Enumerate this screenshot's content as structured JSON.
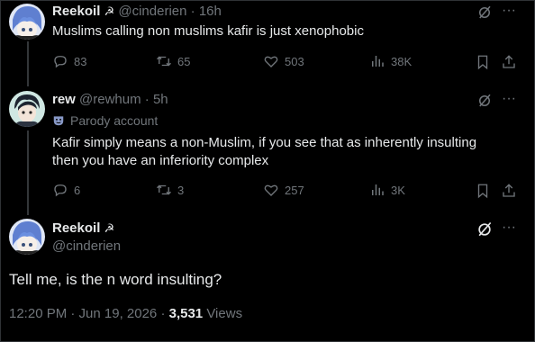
{
  "tweets": [
    {
      "display_name": "Reekoil",
      "badge": "☭",
      "handle": "@cinderien",
      "time": "16h",
      "text": "Muslims calling non muslims kafir is just xenophobic",
      "stats": {
        "replies": "83",
        "reposts": "65",
        "likes": "503",
        "views": "38K"
      }
    },
    {
      "display_name": "rew",
      "handle": "@rewhum",
      "time": "5h",
      "parody_label": "Parody account",
      "text_line1": "Kafir simply means a non-Muslim, if you see that as inherently insulting",
      "text_line2": "then you have an inferiority complex",
      "stats": {
        "replies": "6",
        "reposts": "3",
        "likes": "257",
        "views": "3K"
      }
    }
  ],
  "main": {
    "display_name": "Reekoil",
    "badge": "☭",
    "handle": "@cinderien",
    "text": "Tell me, is the n word insulting?",
    "timestamp": "12:20 PM · Jun 19, 2026 · ",
    "views_count": "3,531",
    "views_label": "Views"
  },
  "separator": "·",
  "more_glyph": "···",
  "colors": {
    "background": "#000000",
    "text": "#e7e9ea",
    "muted": "#71767b",
    "divider": "#2f3336"
  },
  "icons": [
    "grok-icon",
    "more-icon",
    "reply-icon",
    "repost-icon",
    "like-icon",
    "views-icon",
    "bookmark-icon",
    "share-icon",
    "parody-mask-icon"
  ]
}
